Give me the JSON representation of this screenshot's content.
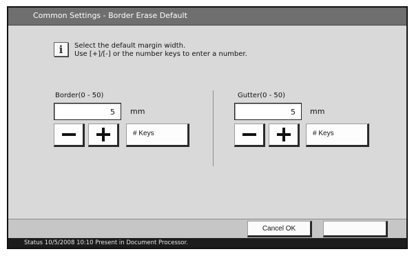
{
  "window": {
    "title": "Common Settings - Border Erase Default"
  },
  "info": {
    "icon": "info-icon",
    "icon_glyph": "i",
    "line1": "Select the default margin width.",
    "line2": "Use [+]/[-] or the number keys to enter a number."
  },
  "border": {
    "label": "Border(0 - 50)",
    "value": "5",
    "unit": "mm",
    "keys_label": "# Keys"
  },
  "gutter": {
    "label": "Gutter(0 - 50)",
    "value": "5",
    "unit": "mm",
    "keys_label": "# Keys"
  },
  "footer": {
    "cancel_label": "Cancel OK",
    "ok_label": ""
  },
  "status": {
    "text": "Status 10/5/2008 10:10 Present in Document Processor."
  },
  "colors": {
    "screen_bg": "#d9d9d9",
    "titlebar": "#6f6f6f",
    "statusbar": "#1c1c1c"
  }
}
